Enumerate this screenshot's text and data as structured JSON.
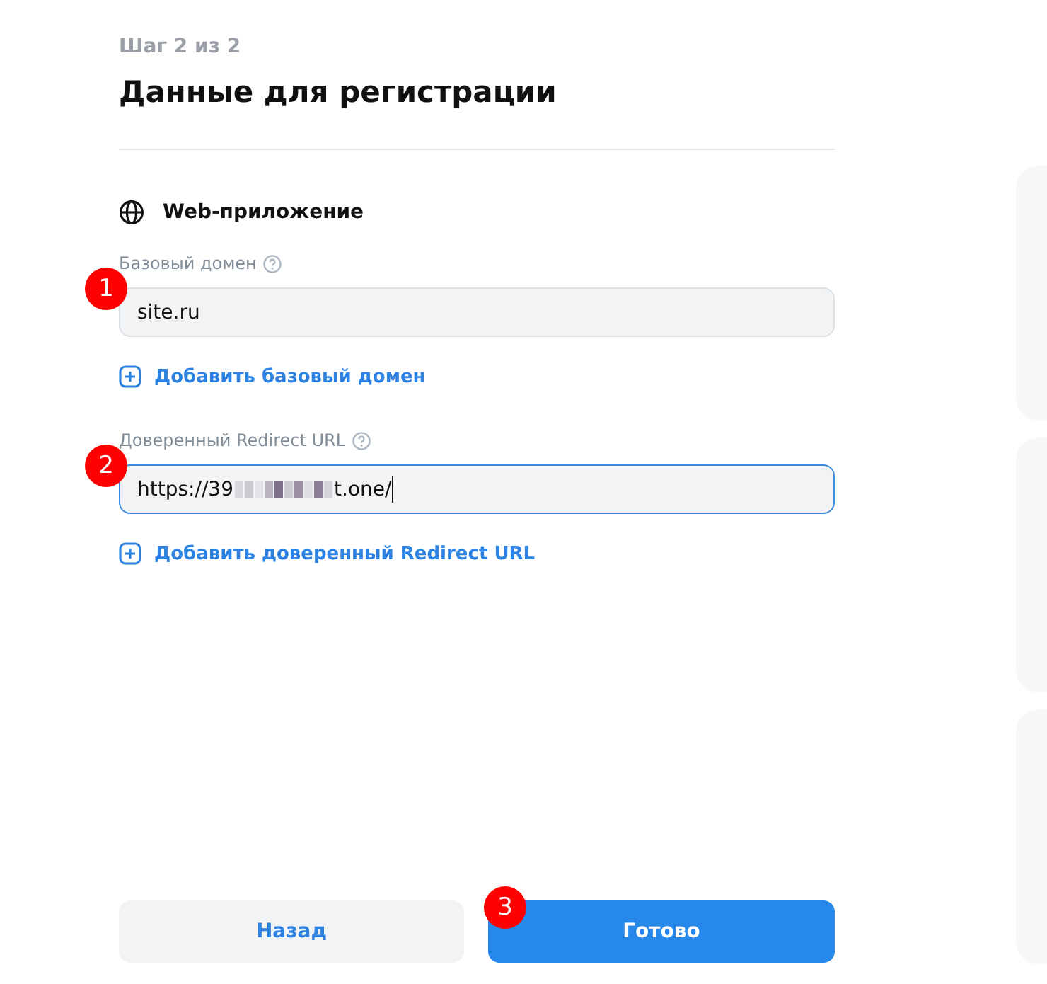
{
  "step": "Шаг 2 из 2",
  "title": "Данные для регистрации",
  "section": {
    "title": "Web-приложение"
  },
  "fields": [
    {
      "label": "Базовый домен",
      "value_start": "site.ru",
      "redacted": false,
      "focused": false,
      "marker": "1",
      "add_link": "Добавить базовый домен"
    },
    {
      "label": "Доверенный Redirect URL",
      "value_start": "https://39",
      "redacted": true,
      "value_end": "t.one/",
      "focused": true,
      "marker": "2",
      "add_link": "Добавить доверенный Redirect URL"
    }
  ],
  "buttons": [
    {
      "label": "Назад",
      "kind": "secondary"
    },
    {
      "label": "Готово",
      "kind": "primary",
      "marker": "3"
    }
  ],
  "side_cards": [
    {
      "kind": "card"
    },
    {
      "kind": "card"
    },
    {
      "kind": "card"
    }
  ]
}
